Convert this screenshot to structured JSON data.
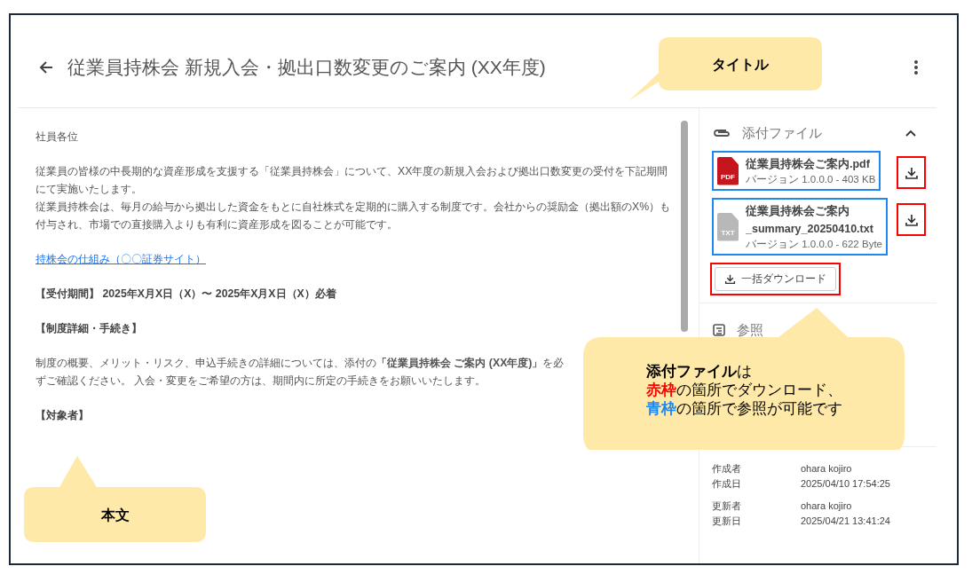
{
  "header": {
    "title": "従業員持株会 新規入会・拠出口数変更のご案内 (XX年度)"
  },
  "body": {
    "salutation": "社員各位",
    "intro": [
      "従業員の皆様の中長期的な資産形成を支援する「従業員持株会」について、XX年度の新規入会および拠出口数変更の受付を下記期間にて実施いたします。",
      "従業員持株会は、毎月の給与から拠出した資金をもとに自社株式を定期的に購入する制度です。会社からの奨励金（拠出額のX%）も付与され、市場での直接購入よりも有利に資産形成を図ることが可能です。"
    ],
    "link": "持株会の仕組み（〇〇証券サイト）",
    "period": "【受付期間】 2025年X月X日（X）〜 2025年X月X日（X）必着",
    "details_heading": "【制度詳細・手続き】",
    "details": "制度の概要、メリット・リスク、申込手続きの詳細については、添付の**「従業員持株会 ご案内 (XX年度)」**を必ずご確認ください。 入会・変更をご希望の方は、期間内に所定の手続きをお願いいたします。",
    "target_heading": "【対象者】"
  },
  "attachments": {
    "title": "添付ファイル",
    "expanded": true,
    "files": [
      {
        "kind": "pdf",
        "badge": "PDF",
        "name": "従業員持株会ご案内.pdf",
        "meta": "バージョン 1.0.0.0 - 403 KB"
      },
      {
        "kind": "txt",
        "badge": "TXT",
        "name": "従業員持株会ご案内\n_summary_20250410.txt",
        "meta": "バージョン 1.0.0.0 - 622 Byte"
      }
    ],
    "bulk_download": {
      "label": "一括ダウンロード"
    }
  },
  "reference": {
    "title": "参照"
  },
  "info": [
    {
      "label": "作成者",
      "value": "ohara kojiro"
    },
    {
      "label": "作成日",
      "value": "2025/04/10 17:54:25"
    },
    {
      "label": "更新者",
      "value": "ohara kojiro"
    },
    {
      "label": "更新日",
      "value": "2025/04/21 13:41:24"
    }
  ],
  "callouts": [
    {
      "kind": "title",
      "lines": [
        [
          {
            "text": "タイトル",
            "bold": true
          }
        ]
      ]
    },
    {
      "kind": "body",
      "lines": [
        [
          {
            "text": "本文",
            "bold": true
          }
        ]
      ]
    },
    {
      "kind": "attachments",
      "lines": [
        [
          {
            "text": "添付ファイル",
            "bold": true
          },
          {
            "text": "は"
          }
        ],
        [
          {
            "text": "赤枠",
            "bold": true,
            "color": "#ff0000"
          },
          {
            "text": "の箇所でダウンロード、"
          }
        ],
        [
          {
            "text": "青枠",
            "bold": true,
            "color": "#1e88f0"
          },
          {
            "text": "の箇所で参照が可能です"
          }
        ]
      ]
    }
  ]
}
